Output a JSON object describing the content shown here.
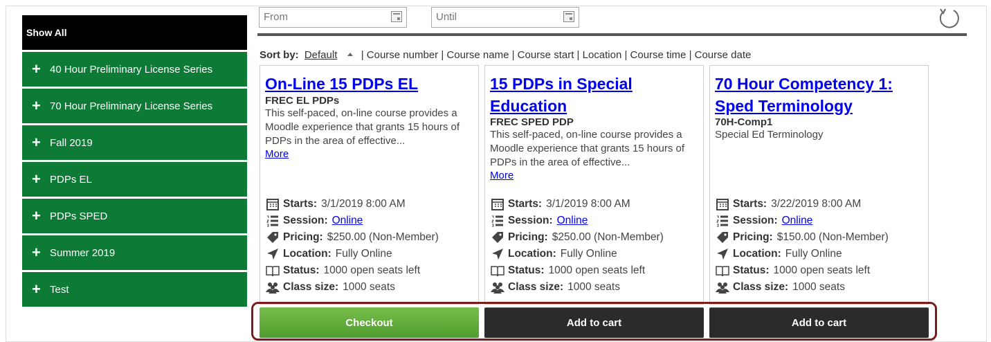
{
  "filters": {
    "from_placeholder": "From",
    "until_placeholder": "Until"
  },
  "sidebar": {
    "show_all": "Show All",
    "categories": [
      "40 Hour Preliminary License Series",
      "70 Hour Preliminary License Series",
      "Fall 2019",
      "PDPs EL",
      "PDPs SPED",
      "Summer 2019",
      "Test"
    ]
  },
  "sort": {
    "label": "Sort by:",
    "default": "Default",
    "options": "| Course number | Course name | Course start | Location | Course time | Course date"
  },
  "labels": {
    "starts": "Starts:",
    "session": "Session:",
    "pricing": "Pricing:",
    "location": "Location:",
    "status": "Status:",
    "class_size": "Class size:"
  },
  "courses": [
    {
      "title": "On-Line 15 PDPs EL",
      "code": "FREC EL PDPs",
      "description": "This self-paced, on-line course provides a Moodle experience that grants 15 hours of PDPs in the area of effective...",
      "more": "More",
      "starts": "3/1/2019 8:00 AM",
      "session": "Online",
      "pricing": "$250.00 (Non-Member)",
      "location": "Fully Online",
      "status": "1000 open seats left",
      "class_size": "1000 seats",
      "button": "Checkout"
    },
    {
      "title": "15 PDPs in Special Education",
      "code": "FREC SPED PDP",
      "description": "This self-paced, on-line course provides a Moodle experience that grants 15 hours of PDPs in the area of effective...",
      "more": "More",
      "starts": "3/1/2019 8:00 AM",
      "session": "Online",
      "pricing": "$250.00 (Non-Member)",
      "location": "Fully Online",
      "status": "1000 open seats left",
      "class_size": "1000 seats",
      "button": "Add to cart"
    },
    {
      "title": "70 Hour Competency 1: Sped Terminology",
      "code": "70H-Comp1",
      "description": "Special Ed Terminology",
      "more": "",
      "starts": "3/22/2019 8:00 AM",
      "session": "Online",
      "pricing": "$150.00 (Non-Member)",
      "location": "Fully Online",
      "status": "1000 open seats left",
      "class_size": "1000 seats",
      "button": "Add to cart"
    }
  ],
  "colors": {
    "sidebar_green": "#0d7a36",
    "checkout_green": "#5fa938",
    "dark_button": "#2b2b2b",
    "highlight_outline": "#7a1c1c",
    "link_blue": "#0000ee"
  }
}
